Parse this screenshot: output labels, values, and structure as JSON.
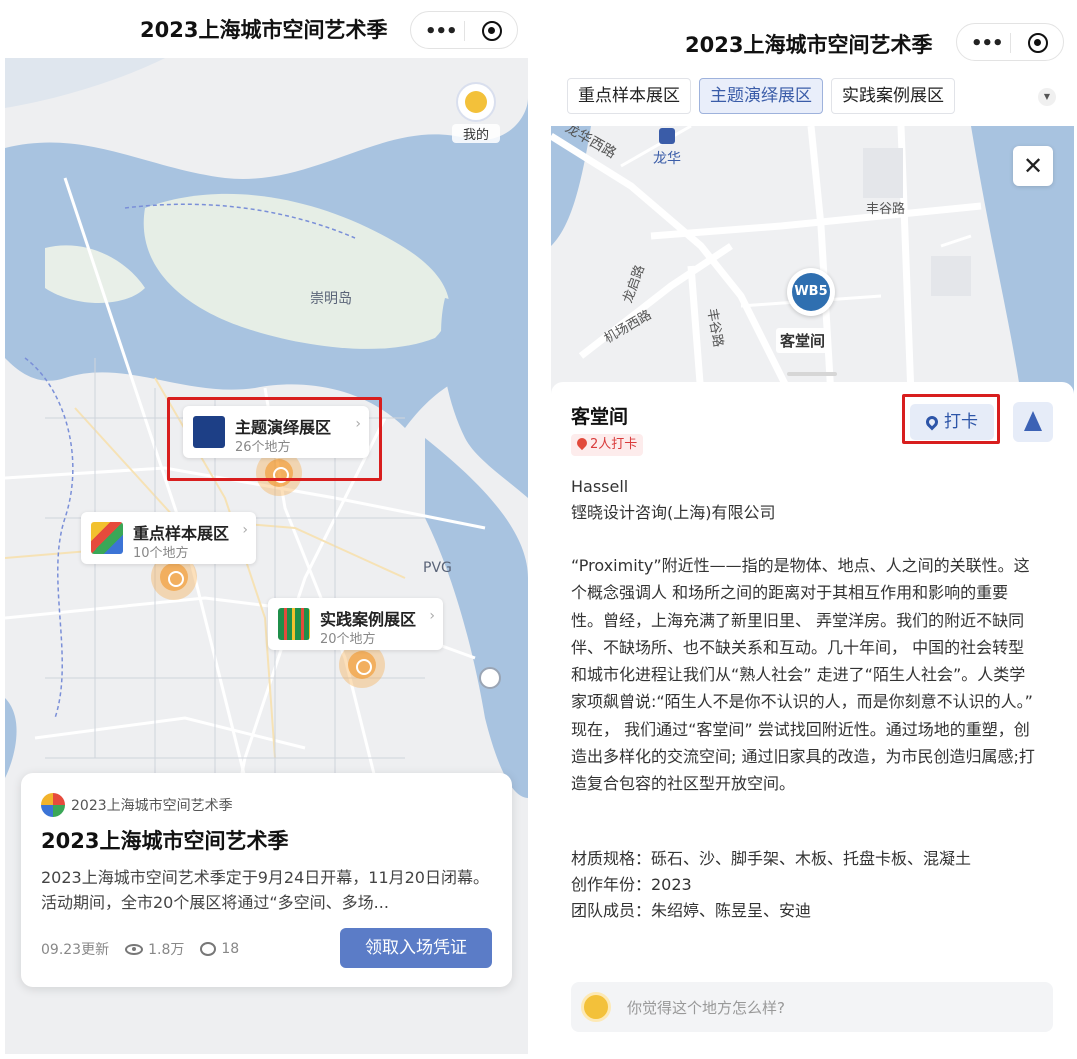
{
  "left": {
    "title": "2023上海城市空间艺术季",
    "me_label": "我的",
    "map_labels": {
      "island": "崇明岛",
      "pvg": "PVG"
    },
    "zones": [
      {
        "name": "主题演绎展区",
        "count": "26个地方"
      },
      {
        "name": "重点样本展区",
        "count": "10个地方"
      },
      {
        "name": "实践案例展区",
        "count": "20个地方"
      }
    ],
    "card": {
      "brand": "2023上海城市空间艺术季",
      "title": "2023上海城市空间艺术季",
      "description": "2023上海城市空间艺术季定于9月24日开幕，11月20日闭幕。活动期间，全市20个展区将通过“多空间、多场...",
      "updated": "09.23更新",
      "views": "1.8万",
      "comments": "18",
      "cta": "领取入场凭证"
    }
  },
  "right": {
    "title": "2023上海城市空间艺术季",
    "tabs": [
      {
        "label": "重点样本展区",
        "active": false
      },
      {
        "label": "主题演绎展区",
        "active": true
      },
      {
        "label": "实践案例展区",
        "active": false
      }
    ],
    "map_labels": {
      "longhua_west": "龙华西路",
      "longhua": "龙华",
      "fenggu": "丰谷路",
      "longqi": "龙启路",
      "jichang_west": "机场西路",
      "fenggu2": "丰谷路"
    },
    "pin_code": "WB5",
    "pin_label": "客堂间",
    "place": {
      "name": "客堂间",
      "checkins": "2人打卡",
      "checkin_button": "打卡",
      "designer": "Hassell",
      "company": "铿晓设计咨询(上海)有限公司",
      "description": "“Proximity”附近性——指的是物体、地点、人之间的关联性。这个概念强调人 和场所之间的距离对于其相互作用和影响的重要性。曾经，上海充满了新里旧里、 弄堂洋房。我们的附近不缺同伴、不缺场所、也不缺关系和互动。几十年间， 中国的社会转型和城市化进程让我们从“熟人社会” 走进了“陌生人社会”。人类学家项飙曾说:“陌生人不是你不认识的人，而是你刻意不认识的人。” 现在， 我们通过“客堂间” 尝试找回附近性。通过场地的重塑，创造出多样化的交流空间; 通过旧家具的改造，为市民创造归属感;打造复合包容的社区型开放空间。",
      "materials": "材质规格：砾石、沙、脚手架、木板、托盘卡板、混凝土",
      "year": "创作年份：2023",
      "team": "团队成员：朱绍婷、陈昱呈、安迪"
    },
    "comment_placeholder": "你觉得这个地方怎么样?"
  },
  "colors": {
    "water": "#a8c3e0",
    "land": "#eeeff1",
    "accent": "#5b7cc7",
    "highlight": "#d81e1e",
    "pulse": "#f4a030"
  }
}
